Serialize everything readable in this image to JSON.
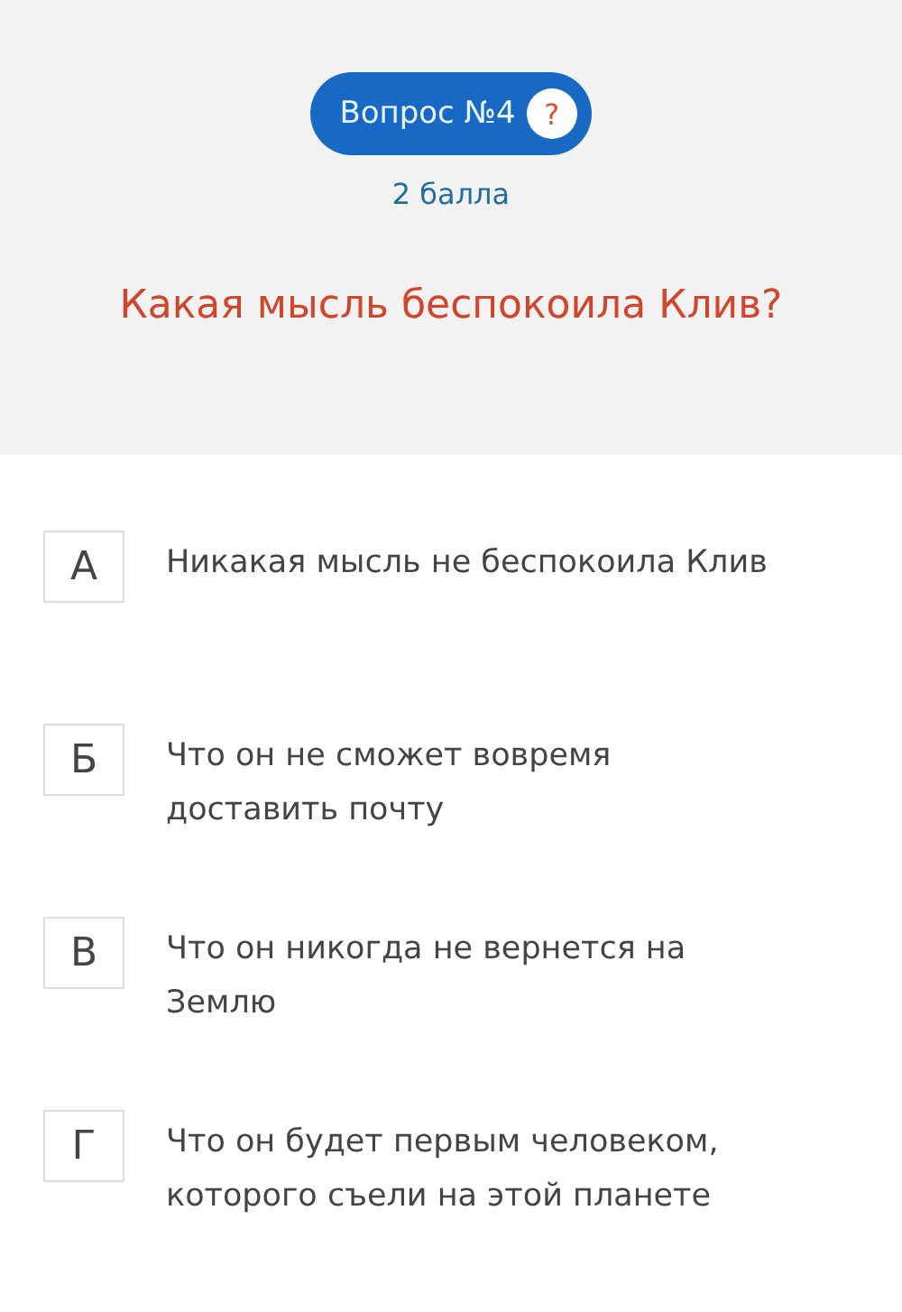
{
  "question": {
    "label": "Вопрос №4",
    "help": "?",
    "points": "2 балла",
    "text": "Какая мысль беспокоила Клив?"
  },
  "answers": [
    {
      "letter": "А",
      "text": "Никакая мысль не беспокоила Клив"
    },
    {
      "letter": "Б",
      "text": "Что он не сможет вовремя доставить почту"
    },
    {
      "letter": "В",
      "text": "Что он никогда не вернется на Землю"
    },
    {
      "letter": "Г",
      "text": "Что он будет первым человеком, которого съели на этой планете"
    }
  ]
}
